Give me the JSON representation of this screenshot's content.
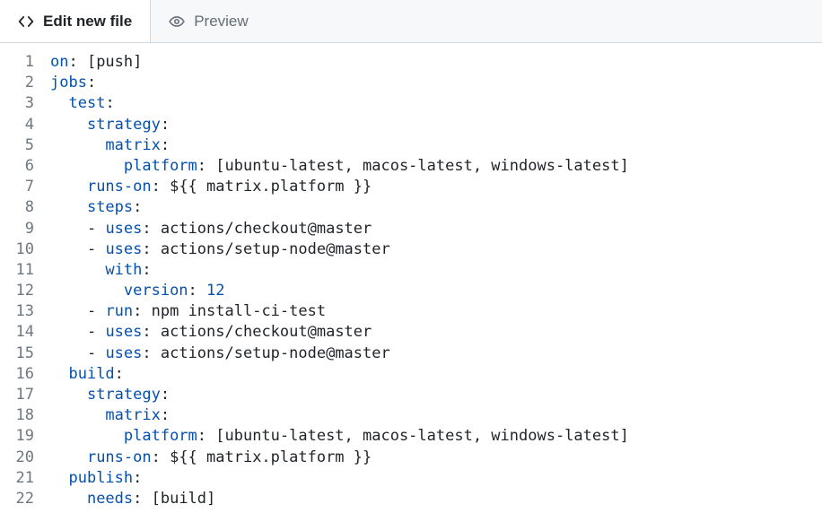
{
  "tabs": {
    "edit": "Edit new file",
    "preview": "Preview"
  },
  "code": {
    "lines": [
      [
        [
          "key",
          "on"
        ],
        [
          "str",
          ": [push]"
        ]
      ],
      [
        [
          "key",
          "jobs"
        ],
        [
          "str",
          ":"
        ]
      ],
      [
        [
          "str",
          "  "
        ],
        [
          "key",
          "test"
        ],
        [
          "str",
          ":"
        ]
      ],
      [
        [
          "str",
          "    "
        ],
        [
          "key",
          "strategy"
        ],
        [
          "str",
          ":"
        ]
      ],
      [
        [
          "str",
          "      "
        ],
        [
          "key",
          "matrix"
        ],
        [
          "str",
          ":"
        ]
      ],
      [
        [
          "str",
          "        "
        ],
        [
          "key",
          "platform"
        ],
        [
          "str",
          ": [ubuntu-latest, macos-latest, windows-latest]"
        ]
      ],
      [
        [
          "str",
          "    "
        ],
        [
          "key",
          "runs-on"
        ],
        [
          "str",
          ": ${{ matrix.platform }}"
        ]
      ],
      [
        [
          "str",
          "    "
        ],
        [
          "key",
          "steps"
        ],
        [
          "str",
          ":"
        ]
      ],
      [
        [
          "str",
          "    "
        ],
        [
          "dash",
          "- "
        ],
        [
          "key",
          "uses"
        ],
        [
          "str",
          ": actions/checkout@master"
        ]
      ],
      [
        [
          "str",
          "    "
        ],
        [
          "dash",
          "- "
        ],
        [
          "key",
          "uses"
        ],
        [
          "str",
          ": actions/setup-node@master"
        ]
      ],
      [
        [
          "str",
          "      "
        ],
        [
          "key",
          "with"
        ],
        [
          "str",
          ":"
        ]
      ],
      [
        [
          "str",
          "        "
        ],
        [
          "key",
          "version"
        ],
        [
          "str",
          ": "
        ],
        [
          "num",
          "12"
        ]
      ],
      [
        [
          "str",
          "    "
        ],
        [
          "dash",
          "- "
        ],
        [
          "key",
          "run"
        ],
        [
          "str",
          ": npm install-ci-test"
        ]
      ],
      [
        [
          "str",
          "    "
        ],
        [
          "dash",
          "- "
        ],
        [
          "key",
          "uses"
        ],
        [
          "str",
          ": actions/checkout@master"
        ]
      ],
      [
        [
          "str",
          "    "
        ],
        [
          "dash",
          "- "
        ],
        [
          "key",
          "uses"
        ],
        [
          "str",
          ": actions/setup-node@master"
        ]
      ],
      [
        [
          "str",
          "  "
        ],
        [
          "key",
          "build"
        ],
        [
          "str",
          ":"
        ]
      ],
      [
        [
          "str",
          "    "
        ],
        [
          "key",
          "strategy"
        ],
        [
          "str",
          ":"
        ]
      ],
      [
        [
          "str",
          "      "
        ],
        [
          "key",
          "matrix"
        ],
        [
          "str",
          ":"
        ]
      ],
      [
        [
          "str",
          "        "
        ],
        [
          "key",
          "platform"
        ],
        [
          "str",
          ": [ubuntu-latest, macos-latest, windows-latest]"
        ]
      ],
      [
        [
          "str",
          "    "
        ],
        [
          "key",
          "runs-on"
        ],
        [
          "str",
          ": ${{ matrix.platform }}"
        ]
      ],
      [
        [
          "str",
          "  "
        ],
        [
          "key",
          "publish"
        ],
        [
          "str",
          ":"
        ]
      ],
      [
        [
          "str",
          "    "
        ],
        [
          "key",
          "needs"
        ],
        [
          "str",
          ": [build]"
        ]
      ]
    ]
  }
}
